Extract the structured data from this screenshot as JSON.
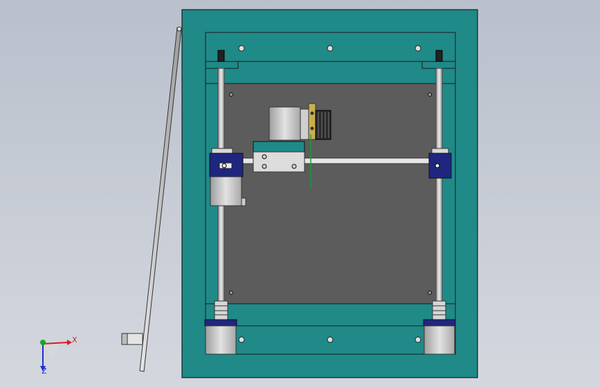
{
  "viewport": {
    "background_top": "#b9c0cc",
    "background_bottom": "#d4d7de"
  },
  "model": {
    "frame_color": "#1f8a88",
    "plate_color": "#5c5c5c",
    "rail_color": "#c9c9c9",
    "block_color": "#1f2680",
    "motor_color": "#c8c8c8",
    "beam_color": "#e6e6e6",
    "green_accent": "#1a9a3a"
  },
  "triad": {
    "x_label": "X",
    "y_label": "Y",
    "z_label": "Z",
    "x_color": "#d41f1f",
    "y_color": "#1fa61f",
    "z_color": "#1f2fd4"
  }
}
